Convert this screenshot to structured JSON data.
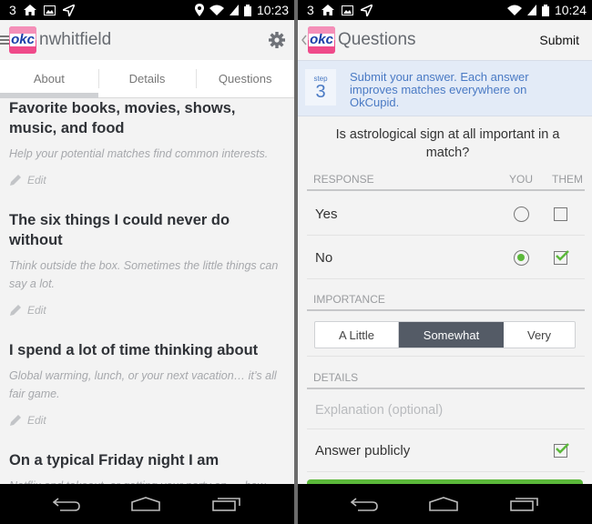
{
  "left": {
    "status": {
      "carrier": "3",
      "time": "10:23"
    },
    "app_title": "nwhitfield",
    "logo_text": "okc",
    "tabs": [
      {
        "label": "About",
        "active": true
      },
      {
        "label": "Details",
        "active": false
      },
      {
        "label": "Questions",
        "active": false
      }
    ],
    "essays": [
      {
        "title": "Favorite books, movies, shows, music, and food",
        "hint": "Help your potential matches find common interests.",
        "edit": "Edit"
      },
      {
        "title": "The six things I could never do without",
        "hint": "Think outside the box. Sometimes the little things can say a lot.",
        "edit": "Edit"
      },
      {
        "title": "I spend a lot of time thinking about",
        "hint": "Global warming, lunch, or your next vacation… it’s all fair game.",
        "edit": "Edit"
      },
      {
        "title": "On a typical Friday night I am",
        "hint": "Netflix and takeout, or getting your party on — how",
        "edit": ""
      }
    ]
  },
  "right": {
    "status": {
      "carrier": "3",
      "time": "10:24"
    },
    "app_title": "Questions",
    "logo_text": "okc",
    "submit_label": "Submit",
    "step": {
      "label": "step",
      "number": "3",
      "text": "Submit your answer. Each answer improves matches everywhere on OkCupid."
    },
    "question": "Is astrological sign at all important in a match?",
    "response_header": {
      "label": "RESPONSE",
      "you": "YOU",
      "them": "THEM"
    },
    "responses": [
      {
        "label": "Yes",
        "you_selected": false,
        "them_checked": false
      },
      {
        "label": "No",
        "you_selected": true,
        "them_checked": true
      }
    ],
    "importance_header": "IMPORTANCE",
    "importance_options": [
      "A Little",
      "Somewhat",
      "Very"
    ],
    "importance_selected": "Somewhat",
    "details_header": "DETAILS",
    "explanation_placeholder": "Explanation (optional)",
    "answer_publicly_label": "Answer publicly",
    "answer_publicly_checked": true
  },
  "colors": {
    "accent_green": "#5bb83a",
    "step_blue": "#4a7ac4",
    "segment_selected": "#545b66"
  }
}
